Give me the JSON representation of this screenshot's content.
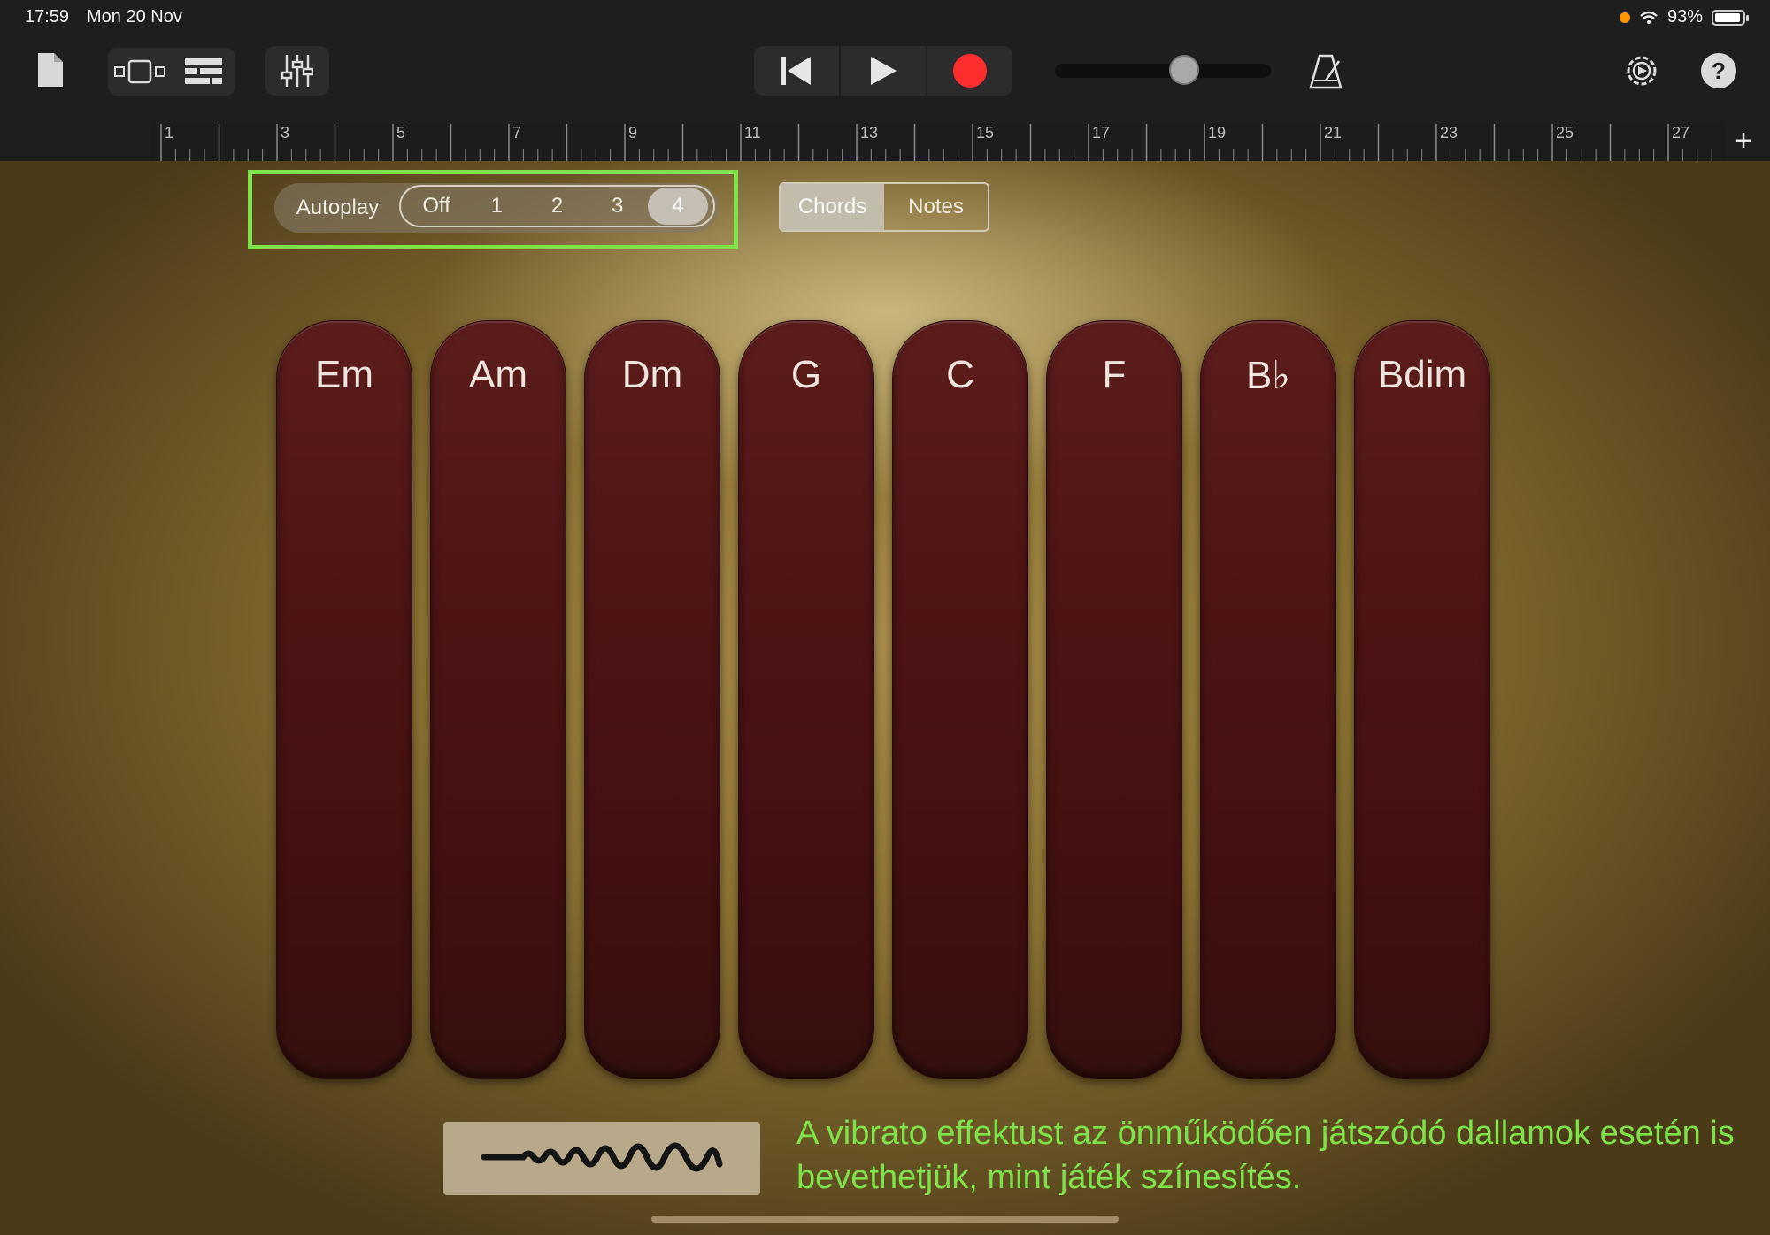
{
  "status": {
    "time": "17:59",
    "date": "Mon 20 Nov",
    "battery": "93%",
    "battery_level": 0.93
  },
  "toolbar": {
    "icons": [
      "document-icon",
      "tracks-view-icon",
      "browser-icon",
      "mixer-icon",
      "go-to-start-icon",
      "play-icon",
      "record-icon",
      "metronome-icon",
      "settings-icon",
      "help-icon"
    ],
    "help_label": "?",
    "record_color": "#ff2d2d",
    "volume_level": 0.6
  },
  "ruler": {
    "marks": [
      "1",
      "3",
      "5",
      "7",
      "9",
      "11",
      "13",
      "15",
      "17",
      "19",
      "21",
      "23",
      "25",
      "27"
    ],
    "add_label": "+"
  },
  "autoplay": {
    "label": "Autoplay",
    "options": [
      "Off",
      "1",
      "2",
      "3",
      "4"
    ],
    "selected": "4"
  },
  "mode": {
    "options": [
      "Chords",
      "Notes"
    ],
    "selected": "Chords"
  },
  "chords": [
    "Em",
    "Am",
    "Dm",
    "G",
    "C",
    "F",
    "B♭",
    "Bdim"
  ],
  "caption": "A vibrato effektust az önműködően játszódó dallamok esetén is bevethetjük, mint játék színesítés.",
  "colors": {
    "highlight": "#7ee34a",
    "chord_strip": "#4f1515",
    "wood": "#8b7233"
  }
}
